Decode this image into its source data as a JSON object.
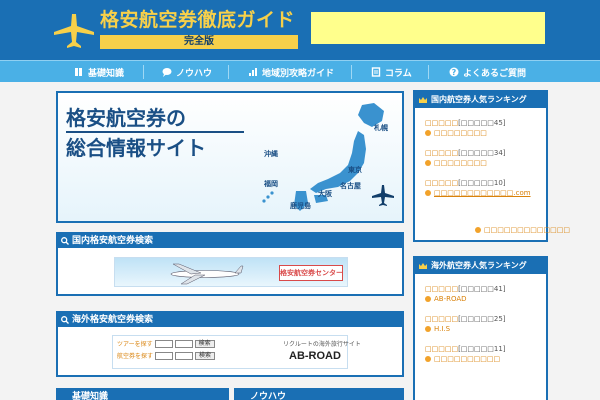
{
  "header": {
    "title": "格安航空券徹底ガイド",
    "subtitle": "完全版"
  },
  "nav": {
    "items": [
      {
        "label": "基礎知識",
        "icon": "book-icon"
      },
      {
        "label": "ノウハウ",
        "icon": "speech-bubble-icon"
      },
      {
        "label": "地域別攻略ガイド",
        "icon": "chart-icon"
      },
      {
        "label": "コラム",
        "icon": "notepad-icon"
      },
      {
        "label": "よくあるご質問",
        "icon": "question-icon"
      }
    ]
  },
  "hero": {
    "line1": "格安航空券の",
    "line2": "総合情報サイト",
    "cities": [
      "札幌",
      "沖縄",
      "福岡",
      "東京",
      "名古屋",
      "大阪",
      "鹿児島"
    ]
  },
  "domestic_search": {
    "title": "国内格安航空券検索",
    "banner_text": "格安航空券センター"
  },
  "international_search": {
    "title": "海外格安航空券検索",
    "row1_label": "ツアーを探す",
    "row2_label": "航空券を探す",
    "search_btn": "検索",
    "banner_small": "リクルートの海外旅行サイト",
    "banner_brand": "AB-ROAD"
  },
  "bottom_cards": {
    "left": "基礎知識",
    "right": "ノウハウ"
  },
  "domestic_ranking": {
    "title": "国内航空券人気ランキング",
    "items": [
      {
        "name": "□□□□□",
        "count": "[□□□□□45]",
        "sub": "□□□□□□□□"
      },
      {
        "name": "□□□□□",
        "count": "[□□□□□34]",
        "sub": "□□□□□□□□"
      },
      {
        "name": "□□□□□",
        "count": "[□□□□□10]",
        "sub": "□□□□□□□□□□□□.com"
      }
    ],
    "more": "□□□□□□□□□□□□□"
  },
  "international_ranking": {
    "title": "海外航空券人気ランキング",
    "items": [
      {
        "name": "□□□□□",
        "count": "[□□□□□41]",
        "sub": "AB-ROAD"
      },
      {
        "name": "□□□□□",
        "count": "[□□□□□25]",
        "sub": "H.I.S"
      },
      {
        "name": "□□□□□",
        "count": "[□□□□□11]",
        "sub": "□□□□□□□□□□"
      }
    ]
  },
  "colors": {
    "primary": "#1a6fb4",
    "nav": "#4ab0e6",
    "accent": "#f7d04a",
    "link": "#d9820b"
  }
}
